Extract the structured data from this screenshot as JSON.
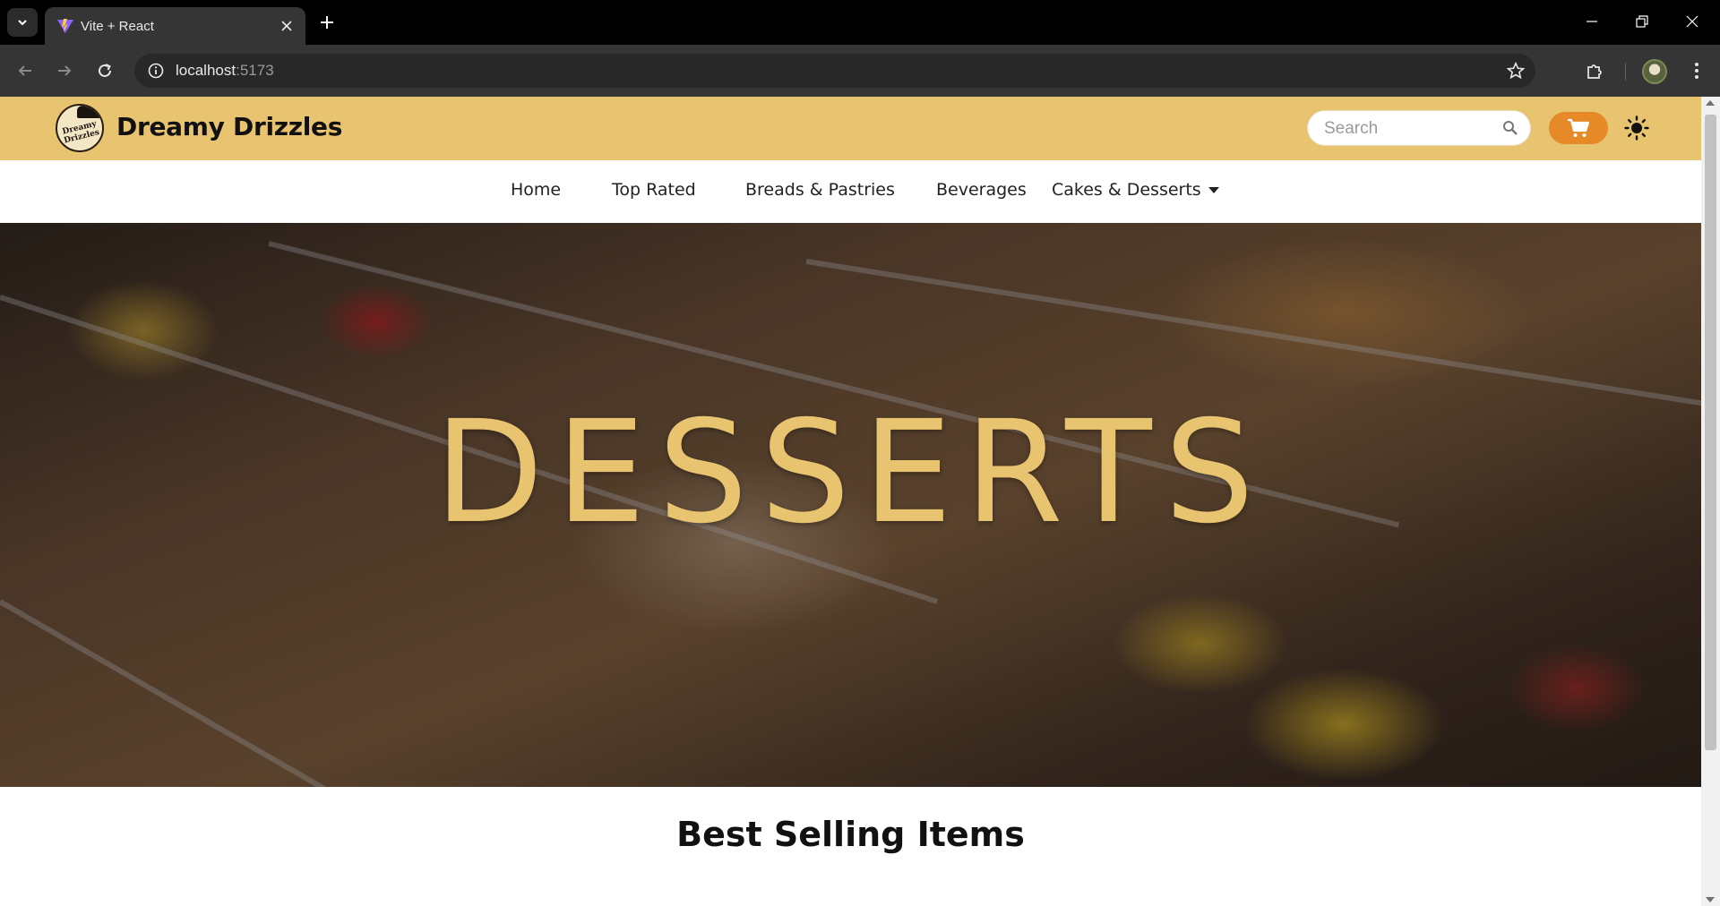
{
  "browser": {
    "tab_title": "Vite + React",
    "url_host": "localhost",
    "url_port": ":5173"
  },
  "site": {
    "brand_name": "Dreamy Drizzles",
    "logo_text": "Dreamy Drizzles",
    "search_placeholder": "Search",
    "accent_color": "#e8c370",
    "cart_color": "#e58a26"
  },
  "nav": {
    "items": [
      {
        "label": "Home"
      },
      {
        "label": "Top Rated"
      },
      {
        "label": "Breads & Pastries"
      },
      {
        "label": "Beverages"
      },
      {
        "label": "Cakes & Desserts"
      }
    ]
  },
  "hero": {
    "title": "DESSERTS"
  },
  "sections": {
    "best_selling_title": "Best Selling Items"
  },
  "icons": {
    "tab_list": "chevron-down-icon",
    "favicon": "vite-logo-icon",
    "close": "close-icon",
    "new_tab": "plus-icon",
    "back": "arrow-left-icon",
    "forward": "arrow-right-icon",
    "reload": "reload-icon",
    "site_info": "info-icon",
    "bookmark": "star-icon",
    "extensions": "puzzle-icon",
    "menu": "kebab-menu-icon",
    "search": "search-icon",
    "cart": "cart-icon",
    "theme": "sun-icon"
  }
}
